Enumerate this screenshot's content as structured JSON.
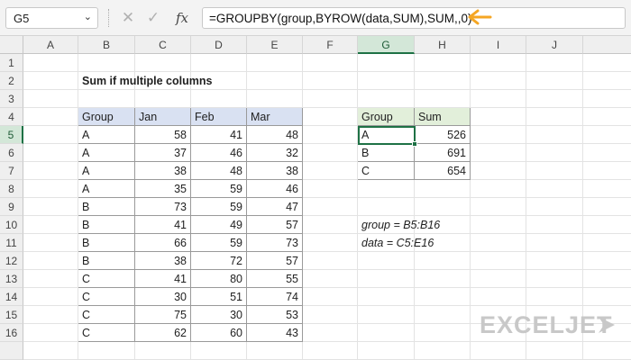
{
  "name_box": {
    "value": "G5"
  },
  "formula": {
    "text": "=GROUPBY(group,BYROW(data,SUM),SUM,,0)"
  },
  "colors": {
    "excel_green": "#1e7145",
    "arrow_orange": "#f5a623",
    "table_blue": "#d9e1f2",
    "table_green": "#e2efda"
  },
  "columns": [
    "A",
    "B",
    "C",
    "D",
    "E",
    "F",
    "G",
    "H",
    "I",
    "J"
  ],
  "rows": [
    "1",
    "2",
    "3",
    "4",
    "5",
    "6",
    "7",
    "8",
    "9",
    "10",
    "11",
    "12",
    "13",
    "14",
    "15",
    "16"
  ],
  "sheet": {
    "title": "Sum if multiple columns",
    "data_table": {
      "headers": [
        "Group",
        "Jan",
        "Feb",
        "Mar"
      ],
      "rows": [
        [
          "A",
          "58",
          "41",
          "48"
        ],
        [
          "A",
          "37",
          "46",
          "32"
        ],
        [
          "A",
          "38",
          "48",
          "38"
        ],
        [
          "A",
          "35",
          "59",
          "46"
        ],
        [
          "B",
          "73",
          "59",
          "47"
        ],
        [
          "B",
          "41",
          "49",
          "57"
        ],
        [
          "B",
          "66",
          "59",
          "73"
        ],
        [
          "B",
          "38",
          "72",
          "57"
        ],
        [
          "C",
          "41",
          "80",
          "55"
        ],
        [
          "C",
          "30",
          "51",
          "74"
        ],
        [
          "C",
          "75",
          "30",
          "53"
        ],
        [
          "C",
          "62",
          "60",
          "43"
        ]
      ]
    },
    "result_table": {
      "headers": [
        "Group",
        "Sum"
      ],
      "rows": [
        [
          "A",
          "526"
        ],
        [
          "B",
          "691"
        ],
        [
          "C",
          "654"
        ]
      ]
    },
    "notes": [
      "group = B5:B16",
      "data = C5:E16"
    ]
  },
  "logo": {
    "text": "EXCELJET"
  }
}
